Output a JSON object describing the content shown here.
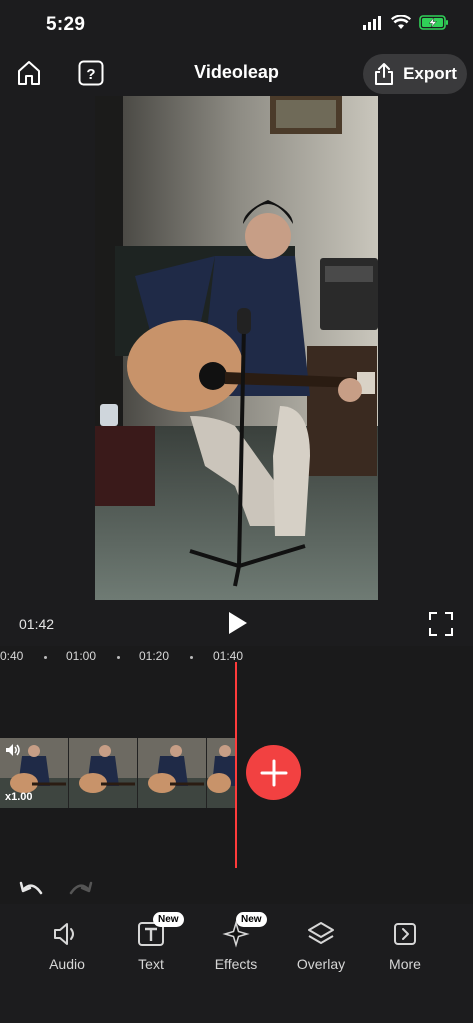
{
  "status": {
    "time": "5:29"
  },
  "nav": {
    "title": "Videoleap",
    "export_label": "Export"
  },
  "player": {
    "current_time": "01:42"
  },
  "ruler": {
    "ticks": [
      "0:40",
      "01:00",
      "01:20",
      "01:40"
    ]
  },
  "clip": {
    "speed": "x1.00"
  },
  "toolbar": {
    "items": [
      {
        "label": "Audio",
        "icon": "speaker-icon"
      },
      {
        "label": "Text",
        "icon": "text-icon",
        "badge": "New"
      },
      {
        "label": "Effects",
        "icon": "sparkle-icon",
        "badge": "New"
      },
      {
        "label": "Overlay",
        "icon": "layers-icon"
      },
      {
        "label": "More",
        "icon": "chevron-right-icon"
      }
    ]
  },
  "colors": {
    "accent": "#f24141",
    "playhead": "#ff3b3b",
    "battery": "#30d158"
  }
}
